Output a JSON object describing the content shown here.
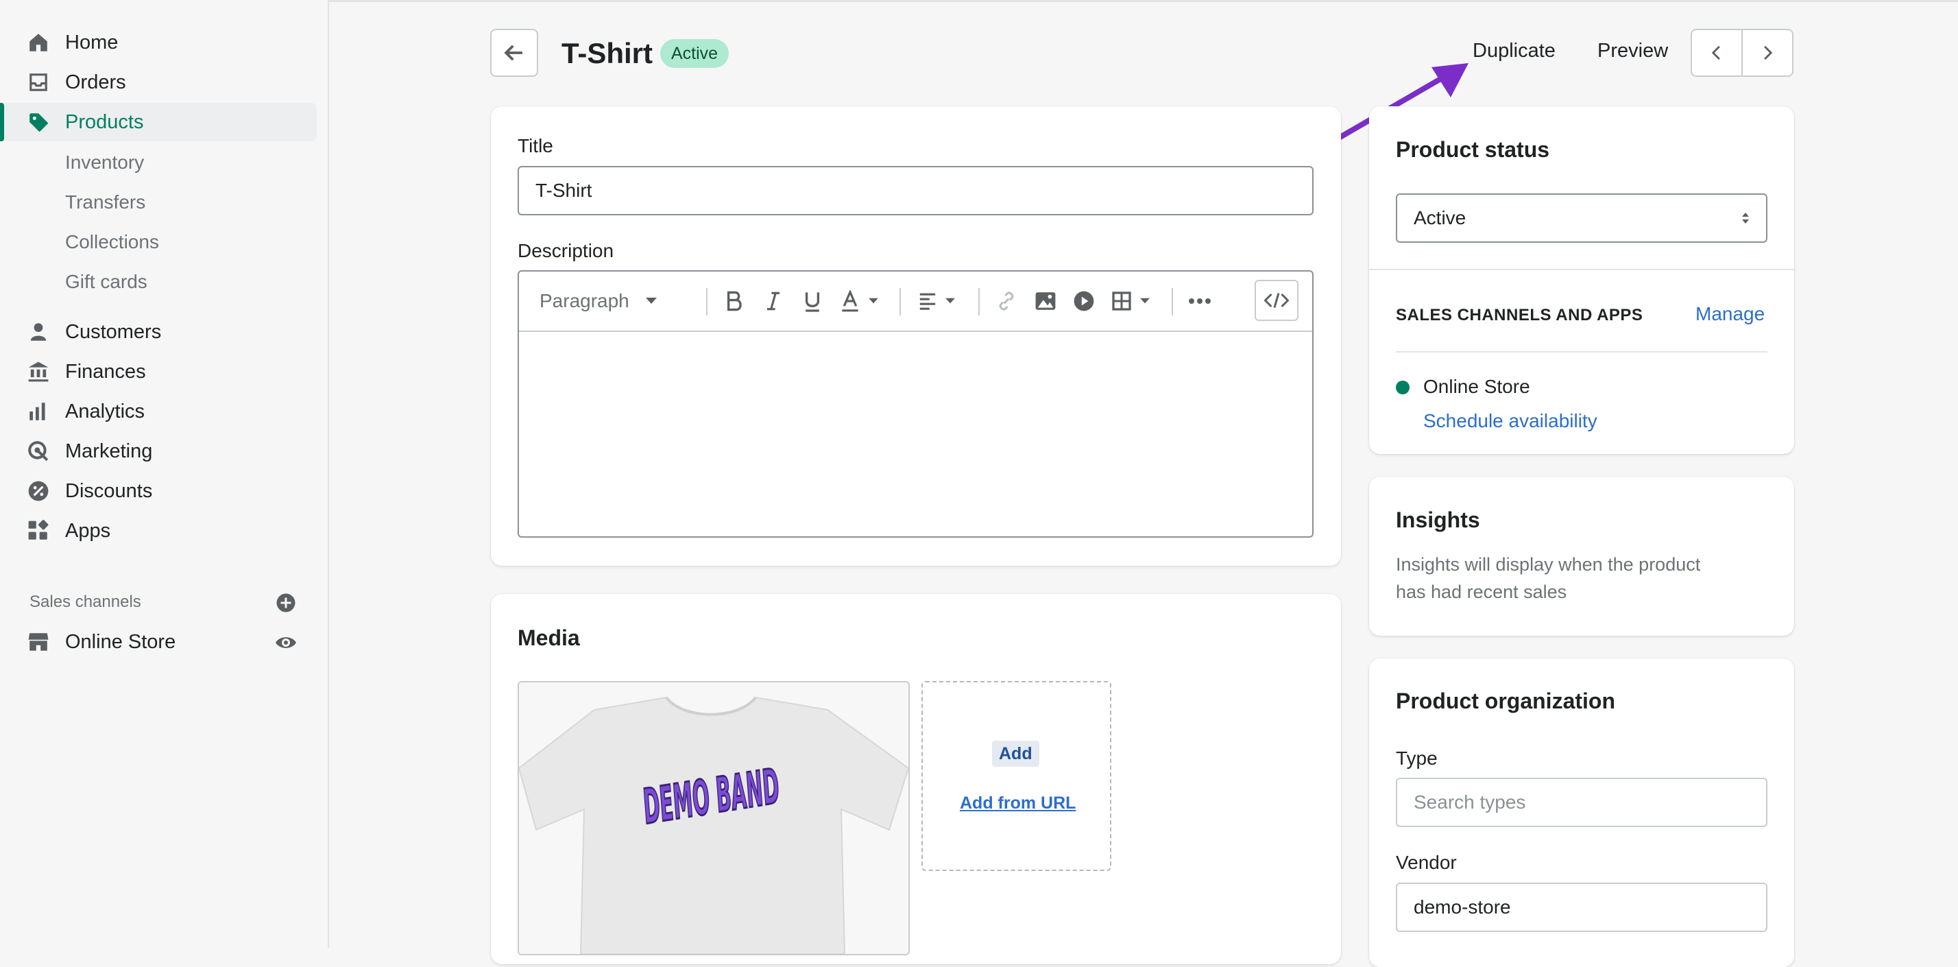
{
  "sidebar": {
    "items": [
      {
        "label": "Home"
      },
      {
        "label": "Orders"
      },
      {
        "label": "Products"
      },
      {
        "label": "Customers"
      },
      {
        "label": "Finances"
      },
      {
        "label": "Analytics"
      },
      {
        "label": "Marketing"
      },
      {
        "label": "Discounts"
      },
      {
        "label": "Apps"
      }
    ],
    "product_subitems": [
      "Inventory",
      "Transfers",
      "Collections",
      "Gift cards"
    ],
    "sales_channels_heading": "Sales channels",
    "online_store": "Online Store"
  },
  "header": {
    "title": "T-Shirt",
    "status_badge": "Active",
    "duplicate": "Duplicate",
    "preview": "Preview"
  },
  "main": {
    "title_label": "Title",
    "title_value": "T-Shirt",
    "description_label": "Description",
    "paragraph_select": "Paragraph",
    "media_heading": "Media",
    "add_button": "Add",
    "add_from_url": "Add from URL",
    "tshirt_print": "DEMO BAND"
  },
  "status_card": {
    "title": "Product status",
    "status_value": "Active",
    "channels_heading": "SALES CHANNELS AND APPS",
    "manage": "Manage",
    "channel_name": "Online Store",
    "schedule": "Schedule availability"
  },
  "insights_card": {
    "title": "Insights",
    "text_line1": "Insights will display when the product",
    "text_line2": "has had recent sales"
  },
  "organization_card": {
    "title": "Product organization",
    "type_label": "Type",
    "type_placeholder": "Search types",
    "vendor_label": "Vendor",
    "vendor_value": "demo-store"
  },
  "colors": {
    "accent": "#008060",
    "link": "#2c6ecb",
    "arrow": "#7a2ec7",
    "badge_bg": "#aee9d1"
  }
}
